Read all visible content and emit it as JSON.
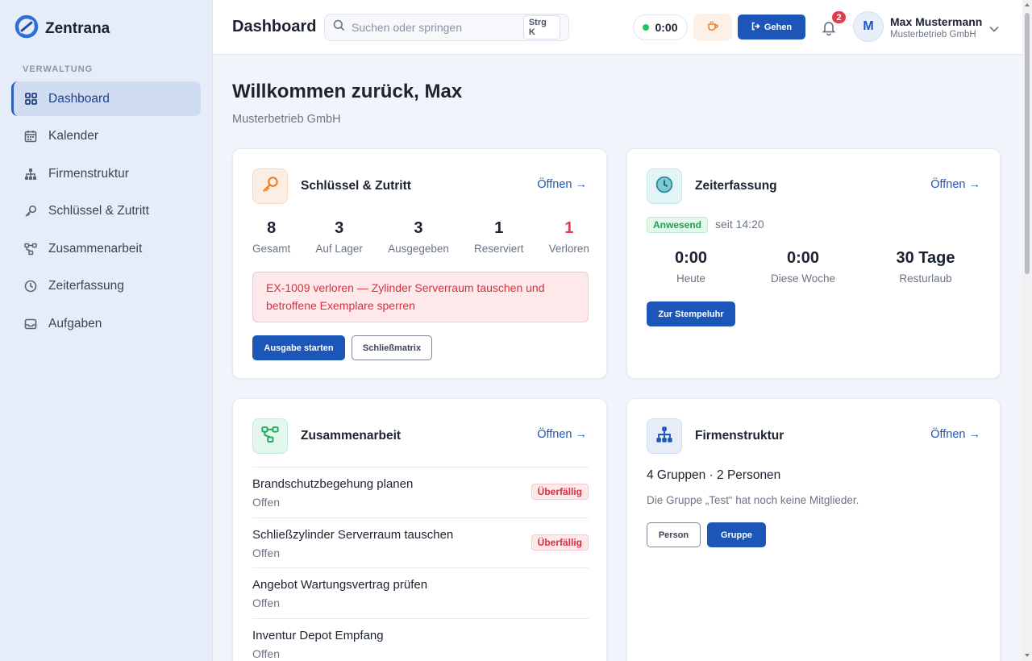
{
  "app": {
    "name": "Zentrana"
  },
  "sidebar": {
    "section": "VERWALTUNG",
    "items": [
      {
        "label": "Dashboard",
        "icon": "grid-icon",
        "active": true
      },
      {
        "label": "Kalender",
        "icon": "calendar-icon"
      },
      {
        "label": "Firmenstruktur",
        "icon": "org-chart-icon"
      },
      {
        "label": "Schlüssel & Zutritt",
        "icon": "key-icon"
      },
      {
        "label": "Zusammenarbeit",
        "icon": "workflow-icon"
      },
      {
        "label": "Zeiterfassung",
        "icon": "clock-icon"
      },
      {
        "label": "Aufgaben",
        "icon": "inbox-icon"
      }
    ]
  },
  "header": {
    "title": "Dashboard",
    "search_placeholder": "Suchen oder springen",
    "search_shortcut": "Strg K",
    "timer": "0:00",
    "go_label": "Gehen",
    "notification_count": "2",
    "avatar_initial": "M",
    "user_name": "Max Mustermann",
    "user_company": "Musterbetrieb GmbH"
  },
  "welcome": {
    "title": "Willkommen zurück, Max",
    "subtitle": "Musterbetrieb GmbH"
  },
  "keys_card": {
    "title": "Schlüssel & Zutritt",
    "open": "Öffnen →",
    "stats": [
      {
        "value": "8",
        "label": "Gesamt"
      },
      {
        "value": "3",
        "label": "Auf Lager"
      },
      {
        "value": "3",
        "label": "Ausgegeben"
      },
      {
        "value": "1",
        "label": "Reserviert"
      },
      {
        "value": "1",
        "label": "Verloren"
      }
    ],
    "alert": "EX-1009 verloren — Zylinder Serverraum tauschen und betroffene Exemplare sperren",
    "primary_button": "Ausgabe starten",
    "secondary_button": "Schließmatrix"
  },
  "time_card": {
    "title": "Zeiterfassung",
    "open": "Öffnen →",
    "status": "Anwesend",
    "since": "seit 14:20",
    "stats": [
      {
        "value": "0:00",
        "label": "Heute"
      },
      {
        "value": "0:00",
        "label": "Diese Woche"
      },
      {
        "value": "30 Tage",
        "label": "Resturlaub"
      }
    ],
    "button": "Zur Stempeluhr"
  },
  "collab_card": {
    "title": "Zusammenarbeit",
    "open": "Öffnen →",
    "tasks": [
      {
        "title": "Brandschutzbegehung planen",
        "status": "Offen",
        "badge": "Überfällig"
      },
      {
        "title": "Schließzylinder Serverraum tauschen",
        "status": "Offen",
        "badge": "Überfällig"
      },
      {
        "title": "Angebot Wartungsvertrag prüfen",
        "status": "Offen"
      },
      {
        "title": "Inventur Depot Empfang",
        "status": "Offen"
      }
    ]
  },
  "org_card": {
    "title": "Firmenstruktur",
    "open": "Öffnen →",
    "summary": "4 Gruppen · 2 Personen",
    "note": "Die Gruppe „Test“ hat noch keine Mitglieder.",
    "person_button": "Person",
    "group_button": "Gruppe"
  },
  "colors": {
    "primary": "#1c56b8",
    "danger": "#e23b4c",
    "success": "#1f9d55",
    "sidebar_bg": "#e6edf8"
  }
}
